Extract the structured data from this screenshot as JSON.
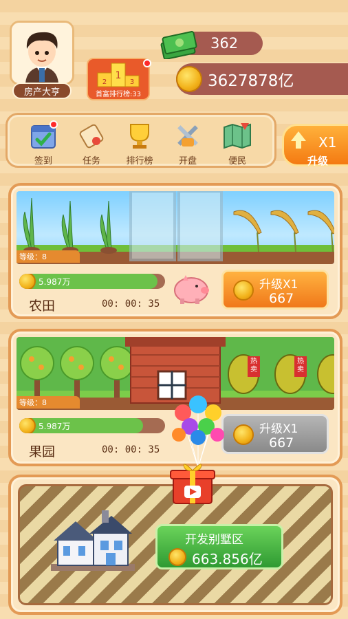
{
  "header": {
    "player_name": "房产大亨",
    "rank_label": "首富排行榜:33",
    "money_value": "362",
    "coin_value": "3627878亿"
  },
  "toolbar": {
    "items": [
      {
        "label": "签到",
        "icon": "calendar-check-icon"
      },
      {
        "label": "任务",
        "icon": "scroll-icon"
      },
      {
        "label": "排行榜",
        "icon": "trophy-icon"
      },
      {
        "label": "开盘",
        "icon": "tools-icon"
      },
      {
        "label": "便民",
        "icon": "map-icon"
      }
    ],
    "upgrade_multiplier": "X1",
    "upgrade_label": "升级"
  },
  "farm": {
    "name": "农田",
    "level": "等级：8",
    "income": "5.987万",
    "progress": 0.95,
    "timer": "00: 00: 35",
    "upgrade_label": "升级X1",
    "upgrade_cost": "667"
  },
  "orchard": {
    "name": "果园",
    "level": "等级：8",
    "income": "5.987万",
    "progress": 0.85,
    "timer": "00: 00: 35",
    "upgrade_label": "升级X1",
    "upgrade_cost": "667",
    "tag_hot": "热卖"
  },
  "villa": {
    "develop_label": "开发别墅区",
    "develop_cost": "663.856亿"
  }
}
